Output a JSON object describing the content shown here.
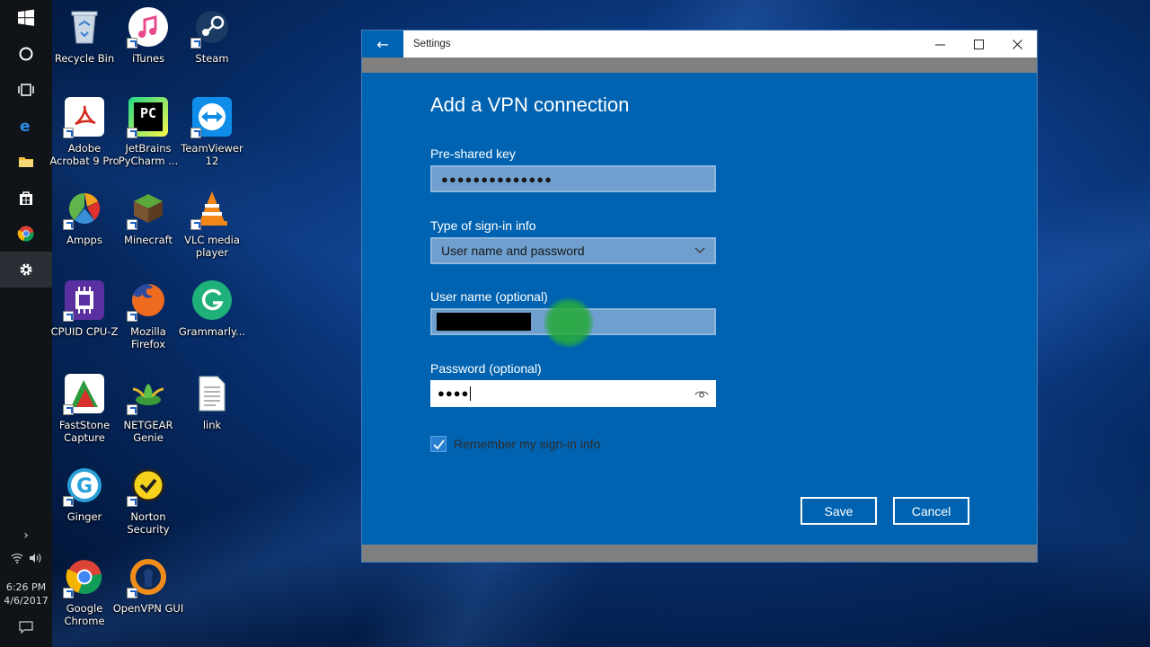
{
  "window": {
    "title": "Settings",
    "minimize_glyph": "—",
    "maximize_glyph": "☐",
    "close_glyph": "✕",
    "back_glyph": "←",
    "accent": "#0063b1"
  },
  "form": {
    "heading": "Add a VPN connection",
    "preshared_label": "Pre-shared key",
    "preshared_value": "●●●●●●●●●●●●●●",
    "signin_type_label": "Type of sign-in info",
    "signin_type_value": "User name and password",
    "username_label": "User name (optional)",
    "password_label": "Password (optional)",
    "password_value": "●●●●",
    "remember_label": "Remember my sign-in info",
    "remember_checked": true
  },
  "buttons": {
    "save": "Save",
    "cancel": "Cancel"
  },
  "desktop_icons": [
    {
      "label": "Recycle Bin",
      "icon": "recycle-bin-icon"
    },
    {
      "label": "iTunes",
      "icon": "itunes-icon"
    },
    {
      "label": "Steam",
      "icon": "steam-icon"
    },
    {
      "label": "Adobe Acrobat 9 Pro",
      "icon": "acrobat-icon"
    },
    {
      "label": "JetBrains PyCharm ...",
      "icon": "pycharm-icon"
    },
    {
      "label": "TeamViewer 12",
      "icon": "teamviewer-icon"
    },
    {
      "label": "Ampps",
      "icon": "ampps-icon"
    },
    {
      "label": "Minecraft",
      "icon": "minecraft-icon"
    },
    {
      "label": "VLC media player",
      "icon": "vlc-icon"
    },
    {
      "label": "CPUID CPU-Z",
      "icon": "cpuz-icon"
    },
    {
      "label": "Mozilla Firefox",
      "icon": "firefox-icon"
    },
    {
      "label": "Grammarly...",
      "icon": "grammarly-icon"
    },
    {
      "label": "FastStone Capture",
      "icon": "faststone-icon"
    },
    {
      "label": "NETGEAR Genie",
      "icon": "netgear-icon"
    },
    {
      "label": "link",
      "icon": "text-file-icon"
    },
    {
      "label": "Ginger",
      "icon": "ginger-icon"
    },
    {
      "label": "Norton Security",
      "icon": "norton-icon"
    },
    {
      "label": "Google Chrome",
      "icon": "chrome-icon"
    },
    {
      "label": "OpenVPN GUI",
      "icon": "openvpn-icon"
    }
  ],
  "taskbar": {
    "time": "6:26 PM",
    "date": "4/6/2017"
  }
}
